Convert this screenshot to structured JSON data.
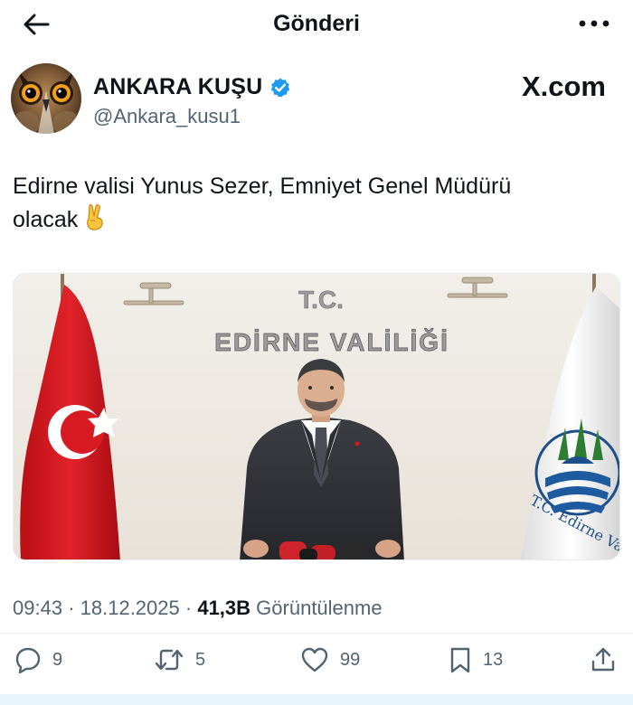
{
  "header": {
    "back_icon": "arrow-left-icon",
    "title": "Gönderi",
    "more_icon": "more-horizontal-icon"
  },
  "author": {
    "display_name": "ANKARA KUŞU",
    "handle": "@Ankara_kusu1",
    "verified_icon": "verified-badge-icon",
    "verified_color": "#1d9bf0",
    "avatar_icon": "owl-avatar-icon"
  },
  "watermark": {
    "text": "X.com"
  },
  "tweet": {
    "text_line1": "Edirne valisi Yunus Sezer, Emniyet Genel Müdürü",
    "text_line2": "olacak",
    "emoji": "victory-hand-icon"
  },
  "media": {
    "sign_top": "T.C.",
    "sign_main": "EDİRNE VALİLİĞİ",
    "logo_text": "T.C. Edirne Va"
  },
  "meta": {
    "time": "09:43",
    "separator": "·",
    "date": "18.12.2025",
    "views_count": "41,3B",
    "views_label": "Görüntülenme"
  },
  "actions": {
    "reply_count": "9",
    "repost_count": "5",
    "like_count": "99",
    "bookmark_count": "13"
  },
  "colors": {
    "text_primary": "#0f1419",
    "text_secondary": "#536471",
    "accent": "#1d9bf0"
  }
}
